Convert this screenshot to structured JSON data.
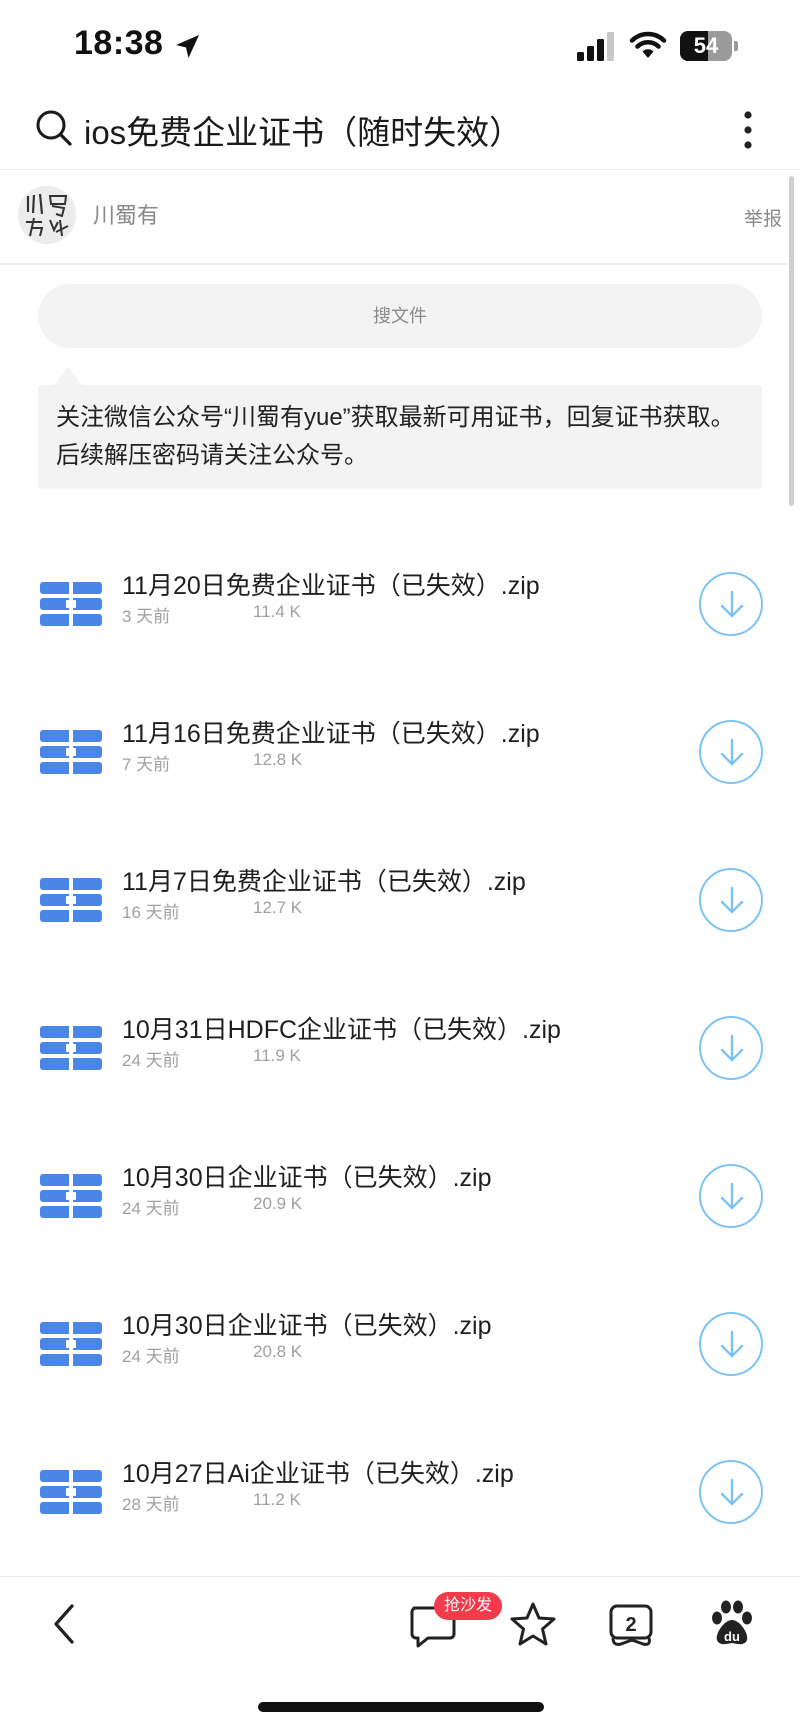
{
  "status_bar": {
    "time": "18:38",
    "battery": "54",
    "battery_level": 0.54
  },
  "header": {
    "search_title": "ios免费企业证书（随时失效）"
  },
  "publisher": {
    "name": "川蜀有",
    "report_label": "举报"
  },
  "file_search": {
    "placeholder": "搜文件"
  },
  "notice": {
    "text": "关注微信公众号“川蜀有yue”获取最新可用证书，回复证书获取。后续解压密码请关注公众号。"
  },
  "files": [
    {
      "name": "11月20日免费企业证书（已失效）.zip",
      "age": "3 天前",
      "size": "11.4 K"
    },
    {
      "name": "11月16日免费企业证书（已失效）.zip",
      "age": "7 天前",
      "size": "12.8 K"
    },
    {
      "name": "11月7日免费企业证书（已失效）.zip",
      "age": "16 天前",
      "size": "12.7 K"
    },
    {
      "name": "10月31日HDFC企业证书（已失效）.zip",
      "age": "24 天前",
      "size": "11.9 K"
    },
    {
      "name": "10月30日企业证书（已失效）.zip",
      "age": "24 天前",
      "size": "20.9 K"
    },
    {
      "name": "10月30日企业证书（已失效）.zip",
      "age": "24 天前",
      "size": "20.8 K"
    },
    {
      "name": "10月27日Ai企业证书（已失效）.zip",
      "age": "28 天前",
      "size": "11.2 K"
    }
  ],
  "bottom_bar": {
    "comment_badge": "抢沙发",
    "tab_count": "2"
  },
  "colors": {
    "accent": "#7cc3f5",
    "file_icon": "#4a86e8",
    "badge": "#f23b4b"
  },
  "icons": [
    "location-arrow-icon",
    "signal-icon",
    "wifi-icon",
    "battery-icon",
    "search-icon",
    "more-icon",
    "zip-file-icon",
    "download-icon",
    "back-icon",
    "comment-icon",
    "star-icon",
    "tabs-icon",
    "baidu-paw-icon"
  ]
}
